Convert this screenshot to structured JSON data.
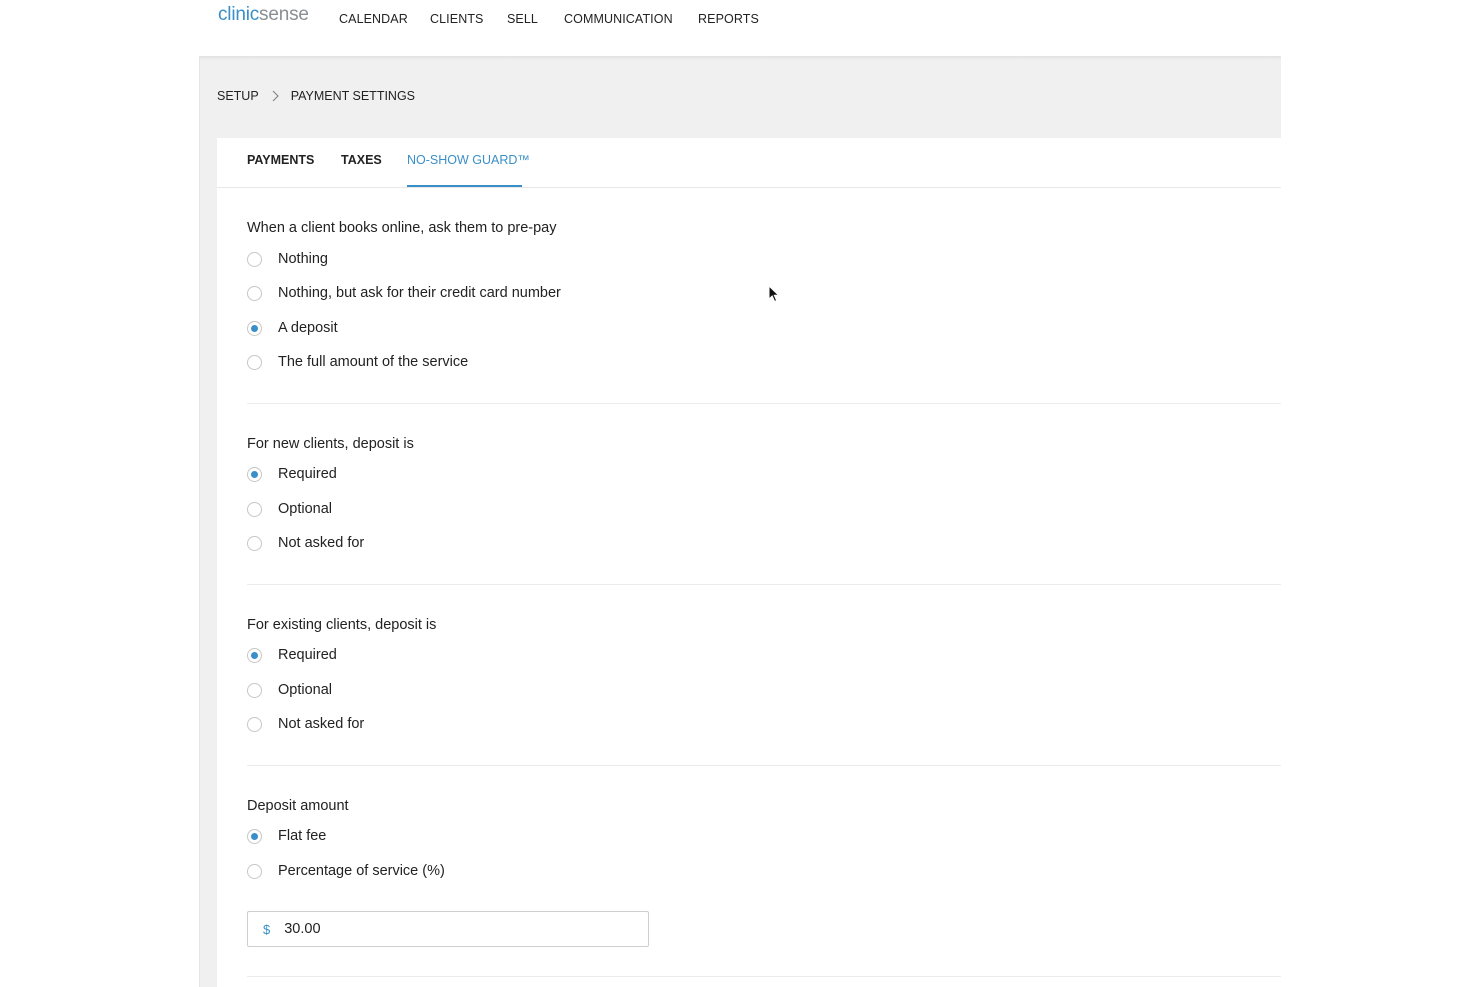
{
  "brand": {
    "part1": "clinic",
    "part2": "sense"
  },
  "nav": {
    "items": [
      {
        "label": "CALENDAR"
      },
      {
        "label": "CLIENTS"
      },
      {
        "label": "SELL"
      },
      {
        "label": "COMMUNICATION"
      },
      {
        "label": "REPORTS"
      }
    ]
  },
  "breadcrumb": {
    "items": [
      "SETUP",
      "PAYMENT SETTINGS"
    ]
  },
  "tabs": [
    {
      "label": "PAYMENTS",
      "active": false
    },
    {
      "label": "TAXES",
      "active": false
    },
    {
      "label": "NO-SHOW GUARD™",
      "active": true
    }
  ],
  "sections": {
    "prepay": {
      "label": "When a client books online, ask them to pre-pay",
      "options": [
        {
          "label": "Nothing",
          "selected": false
        },
        {
          "label": "Nothing, but ask for their credit card number",
          "selected": false
        },
        {
          "label": "A deposit",
          "selected": true
        },
        {
          "label": "The full amount of the service",
          "selected": false
        }
      ]
    },
    "new_clients": {
      "label": "For new clients, deposit is",
      "options": [
        {
          "label": "Required",
          "selected": true
        },
        {
          "label": "Optional",
          "selected": false
        },
        {
          "label": "Not asked for",
          "selected": false
        }
      ]
    },
    "existing_clients": {
      "label": "For existing clients, deposit is",
      "options": [
        {
          "label": "Required",
          "selected": true
        },
        {
          "label": "Optional",
          "selected": false
        },
        {
          "label": "Not asked for",
          "selected": false
        }
      ]
    },
    "deposit_amount": {
      "label": "Deposit amount",
      "options": [
        {
          "label": "Flat fee",
          "selected": true
        },
        {
          "label": "Percentage of service (%)",
          "selected": false
        }
      ],
      "currency_symbol": "$",
      "value": "30.00"
    }
  },
  "colors": {
    "accent": "#3a8fc8",
    "band": "#f0f0f0"
  }
}
